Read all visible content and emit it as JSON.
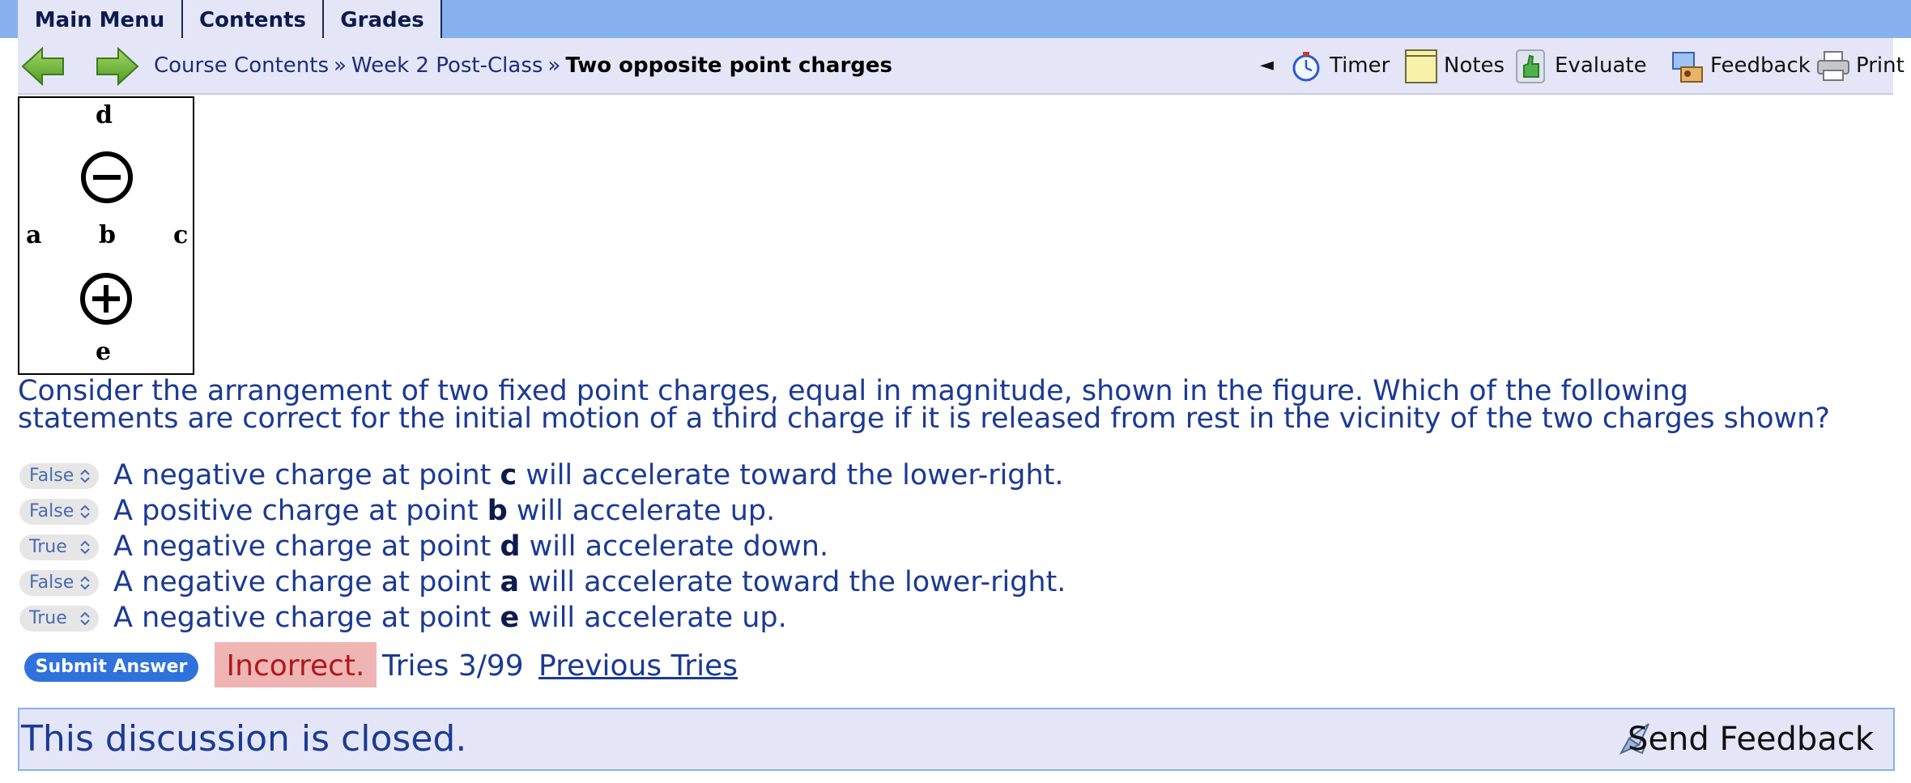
{
  "menu": {
    "tabs": [
      {
        "label": "Main Menu"
      },
      {
        "label": "Contents"
      },
      {
        "label": "Grades"
      }
    ]
  },
  "nav": {
    "back_icon": "back-arrow-icon",
    "forward_icon": "forward-arrow-icon",
    "breadcrumb": [
      "Course Contents",
      "Week 2 Post-Class",
      "Two opposite point charges"
    ],
    "separator": "»",
    "collapse_glyph": "◄",
    "tools": [
      {
        "label": "Timer",
        "icon": "stopwatch-icon"
      },
      {
        "label": "Notes",
        "icon": "notepad-icon"
      },
      {
        "label": "Evaluate",
        "icon": "thumbs-up-icon"
      },
      {
        "label": "Feedback",
        "icon": "feedback-icon"
      },
      {
        "label": "Print",
        "icon": "printer-icon"
      }
    ]
  },
  "figure": {
    "labels": {
      "a": "a",
      "b": "b",
      "c": "c",
      "d": "d",
      "e": "e"
    },
    "charges": [
      "negative",
      "positive"
    ]
  },
  "question": {
    "prompt": "Consider the arrangement of two fixed point charges, equal in magnitude, shown in the figure. Which of the following statements are correct for the initial motion of a third charge if it is released from rest in the vicinity of the two charges shown?",
    "statements": [
      {
        "answer": "False",
        "pre": "A negative charge at point ",
        "point": "c",
        "post": " will accelerate toward the lower-right."
      },
      {
        "answer": "False",
        "pre": "A positive charge at point ",
        "point": "b",
        "post": " will accelerate up."
      },
      {
        "answer": "True",
        "pre": "A negative charge at point ",
        "point": "d",
        "post": " will accelerate down."
      },
      {
        "answer": "False",
        "pre": "A negative charge at point ",
        "point": "a",
        "post": " will accelerate toward the lower-right."
      },
      {
        "answer": "True",
        "pre": "A negative charge at point ",
        "point": "e",
        "post": " will accelerate up."
      }
    ]
  },
  "status": {
    "submit_label": "Submit Answer",
    "result": "Incorrect.",
    "tries": "Tries 3/99",
    "previous_tries": "Previous Tries"
  },
  "discussion": {
    "closed_text": "This discussion is closed.",
    "send_feedback": "Send Feedback",
    "send_feedback_icon": "send-feedback-icon"
  },
  "colors": {
    "topbar": "#87b1ec",
    "navbar": "#e4e6f7",
    "text_blue": "#1b3a94",
    "incorrect_bg": "#efb5b5",
    "submit_bg": "#2f72dc"
  }
}
